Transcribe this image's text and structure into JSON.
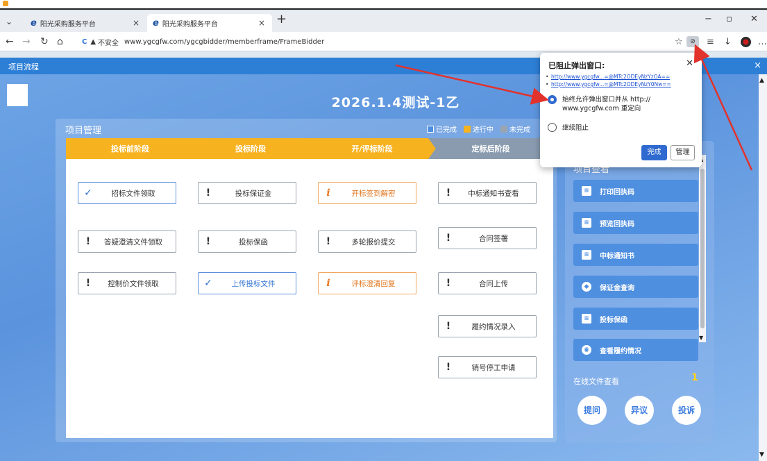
{
  "browser": {
    "tabs": [
      {
        "label": "阳光采购服务平台",
        "close": "×"
      },
      {
        "label": "阳光采购服务平台",
        "close": "×"
      }
    ],
    "new_tab": "+",
    "url": {
      "insecure_label": "不安全",
      "address": "www.ygcgfw.com/ygcgbidder/memberframe/FrameBidder"
    }
  },
  "page": {
    "header_title": "项目流程",
    "project_title": "2026.1.4测试-1乙",
    "mgmt_title": "项目管理",
    "legend": [
      {
        "label": "已完成",
        "color": "#4f8fe0"
      },
      {
        "label": "进行中",
        "color": "#f7b21f"
      },
      {
        "label": "未完成",
        "color": "#9aa5b1"
      }
    ],
    "stages": [
      {
        "label": "投标前阶段",
        "color": "#f7b21f"
      },
      {
        "label": "投标阶段",
        "color": "#f7b21f"
      },
      {
        "label": "开/评标阶段",
        "color": "#f7b21f"
      },
      {
        "label": "定标后阶段",
        "color": "#8a9bb0"
      }
    ],
    "steps": {
      "col1": [
        {
          "label": "招标文件领取",
          "icon": "✓",
          "state": "done"
        },
        {
          "label": "答疑澄清文件领取",
          "icon": "!",
          "state": "pending"
        },
        {
          "label": "控制价文件领取",
          "icon": "!",
          "state": "pending"
        }
      ],
      "col2": [
        {
          "label": "投标保证金",
          "icon": "!",
          "state": "pending"
        },
        {
          "label": "投标保函",
          "icon": "!",
          "state": "pending"
        },
        {
          "label": "上传投标文件",
          "icon": "✓",
          "state": "done"
        }
      ],
      "col3": [
        {
          "label": "开标签到解密",
          "icon": "i",
          "state": "info"
        },
        {
          "label": "多轮报价提交",
          "icon": "!",
          "state": "pending"
        },
        {
          "label": "评标澄清回复",
          "icon": "i",
          "state": "info"
        }
      ],
      "col4": [
        {
          "label": "中标通知书查看",
          "icon": "!",
          "state": "pending"
        },
        {
          "label": "合同签署",
          "icon": "!",
          "state": "pending"
        },
        {
          "label": "合同上传",
          "icon": "!",
          "state": "pending"
        },
        {
          "label": "履约情况录入",
          "icon": "!",
          "state": "pending"
        },
        {
          "label": "销号停工申请",
          "icon": "!",
          "state": "pending"
        }
      ]
    },
    "right_panel": {
      "view_title": "项目查看",
      "buttons": [
        {
          "label": "打印回执码",
          "icon": "document-icon"
        },
        {
          "label": "预览回执码",
          "icon": "document-icon"
        },
        {
          "label": "中标通知书",
          "icon": "document-icon"
        },
        {
          "label": "保证金查询",
          "icon": "shield-icon"
        },
        {
          "label": "投标保函",
          "icon": "document-icon"
        },
        {
          "label": "查看履约情况",
          "icon": "eye-icon"
        }
      ],
      "online_label": "在线文件查看",
      "online_count": "1",
      "circle_buttons": [
        "提问",
        "异议",
        "投诉"
      ]
    }
  },
  "popup": {
    "title": "已阻止弹出窗口:",
    "links": [
      "http://www.ygcgfw...=@MTc2ODEyNzYzOA==",
      "http://www.ygcgfw...=@MTc2ODEyNzY0Nw=="
    ],
    "option_allow_line1": "始终允许弹出窗口并从 http://",
    "option_allow_line2": "www.ygcgfw.com 重定向",
    "option_block": "继续阻止",
    "done_label": "完成",
    "manage_label": "管理"
  }
}
